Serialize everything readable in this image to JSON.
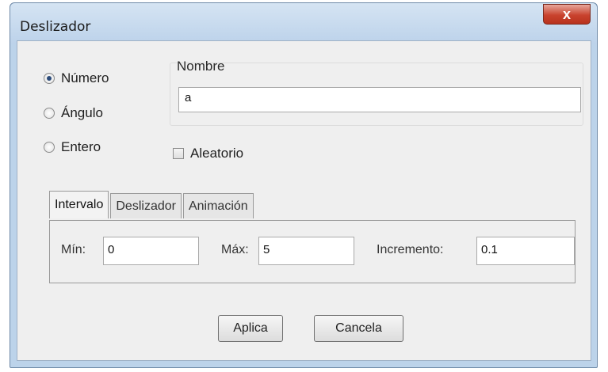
{
  "window": {
    "title": "Deslizador",
    "close_label": "x"
  },
  "type_options": [
    {
      "label": "Número",
      "selected": true
    },
    {
      "label": "Ángulo",
      "selected": false
    },
    {
      "label": "Entero",
      "selected": false
    }
  ],
  "name": {
    "label": "Nombre",
    "value": "a"
  },
  "random": {
    "label": "Aleatorio",
    "checked": false
  },
  "tabs": [
    {
      "label": "Intervalo",
      "active": true
    },
    {
      "label": "Deslizador",
      "active": false
    },
    {
      "label": "Animación",
      "active": false
    }
  ],
  "interval": {
    "min_label": "Mín:",
    "min_value": "0",
    "max_label": "Máx:",
    "max_value": "5",
    "increment_label": "Incremento:",
    "increment_value": "0.1"
  },
  "buttons": {
    "apply": "Aplica",
    "cancel": "Cancela"
  },
  "colors": {
    "titlebar": "#bcd3ea",
    "close_button": "#c9432e",
    "dialog_body": "#efefef"
  }
}
